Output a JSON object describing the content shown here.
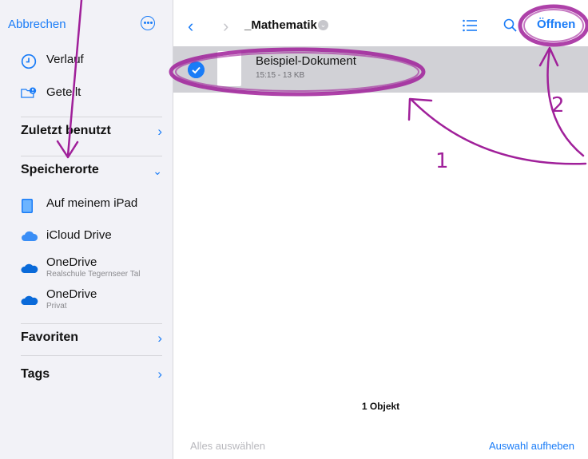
{
  "sidebar": {
    "cancel_label": "Abbrechen",
    "items": [
      {
        "label": "Verlauf",
        "icon": "clock-icon"
      },
      {
        "label": "Geteilt",
        "icon": "shared-folder-icon"
      }
    ],
    "recent_label": "Zuletzt benutzt",
    "locations_label": "Speicherorte",
    "locations": [
      {
        "name": "Auf meinem iPad",
        "sub": "",
        "icon": "ipad-icon"
      },
      {
        "name": "iCloud Drive",
        "sub": "",
        "icon": "icloud-icon"
      },
      {
        "name": "OneDrive",
        "sub": "Realschule Tegernseer Tal",
        "icon": "onedrive-icon"
      },
      {
        "name": "OneDrive",
        "sub": "Privat",
        "icon": "onedrive-icon"
      }
    ],
    "favorites_label": "Favoriten",
    "tags_label": "Tags"
  },
  "toolbar": {
    "folder_title": "_Mathematik",
    "open_label": "Öffnen"
  },
  "file": {
    "name": "Beispiel-Dokument",
    "meta": "15:15 - 13 KB"
  },
  "footer": {
    "count": "1 Objekt",
    "select_all": "Alles auswählen",
    "deselect": "Auswahl aufheben"
  },
  "annotations": {
    "label_1": "1",
    "label_2": "2",
    "color": "#a0209a"
  },
  "colors": {
    "accent": "#1a7cf7",
    "sidebar_bg": "#f2f2f7",
    "selected_row": "#d1d1d6"
  }
}
